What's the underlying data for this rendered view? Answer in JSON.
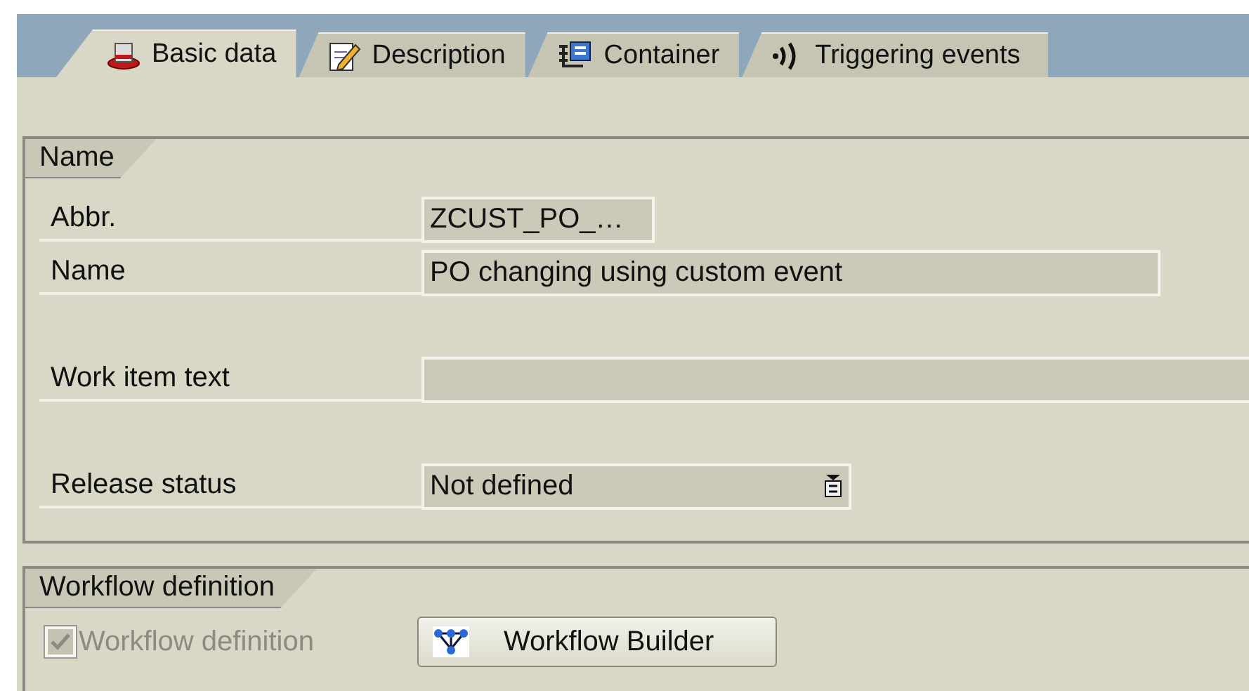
{
  "tabs": [
    {
      "label": "Basic data",
      "selected": true
    },
    {
      "label": "Description",
      "selected": false
    },
    {
      "label": "Container",
      "selected": false
    },
    {
      "label": "Triggering events",
      "selected": false
    }
  ],
  "name_group": {
    "title": "Name",
    "fields": [
      {
        "label": "Abbr.",
        "value": "ZCUST_PO_…",
        "kind": "short"
      },
      {
        "label": "Name",
        "value": "PO changing using custom event",
        "kind": "medium"
      },
      {
        "label": "Work item text",
        "kind": "wide"
      },
      {
        "label": "Release status",
        "value": "Not defined",
        "kind": "dropdown"
      }
    ]
  },
  "workflow_group": {
    "title": "Workflow definition",
    "checkbox": {
      "label": "Workflow definition",
      "checked": true,
      "disabled": true
    },
    "button": {
      "label": "Workflow Builder"
    }
  }
}
